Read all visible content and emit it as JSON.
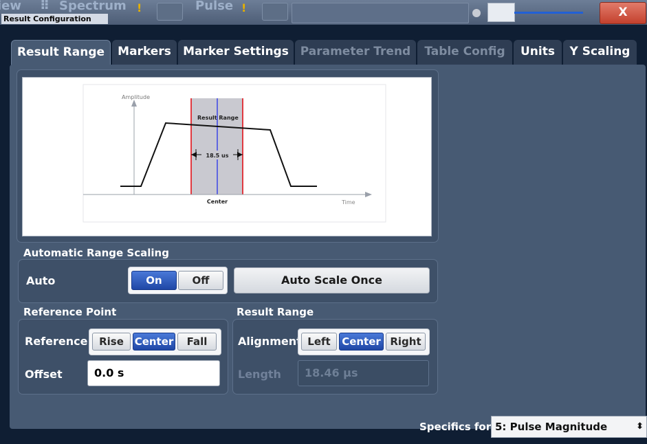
{
  "window": {
    "title": "Result Configuration",
    "background_fragments": [
      "iew",
      "Spectrum",
      "Pulse"
    ],
    "close_label": "X",
    "accent": "#2160d6",
    "close_color": "#c3412e"
  },
  "tabs": [
    {
      "label": "Result Range",
      "state": "active"
    },
    {
      "label": "Markers",
      "state": "normal"
    },
    {
      "label": "Marker Settings",
      "state": "normal"
    },
    {
      "label": "Parameter Trend",
      "state": "disabled"
    },
    {
      "label": "Table Config",
      "state": "disabled"
    },
    {
      "label": "Units",
      "state": "normal"
    },
    {
      "label": "Y Scaling",
      "state": "normal"
    }
  ],
  "diagram": {
    "y_axis_label": "Amplitude",
    "x_axis_label": "Time",
    "range_label": "Result Range",
    "length_label": "18.5 us",
    "center_label": "Center"
  },
  "auto_scaling": {
    "heading": "Automatic Range Scaling",
    "auto_label": "Auto",
    "on_label": "On",
    "off_label": "Off",
    "selected": "On",
    "scale_once_label": "Auto Scale Once"
  },
  "reference_point": {
    "heading": "Reference Point",
    "reference_label": "Reference",
    "options": [
      "Rise",
      "Center",
      "Fall"
    ],
    "selected": "Center",
    "offset_label": "Offset",
    "offset_value": "0.0 s"
  },
  "result_range": {
    "heading": "Result Range",
    "alignment_label": "Alignment",
    "options": [
      "Left",
      "Center",
      "Right"
    ],
    "selected": "Center",
    "length_label": "Length",
    "length_value": "18.46 µs"
  },
  "footer": {
    "specifics_label": "Specifics for",
    "specifics_value": "5: Pulse Magnitude"
  }
}
